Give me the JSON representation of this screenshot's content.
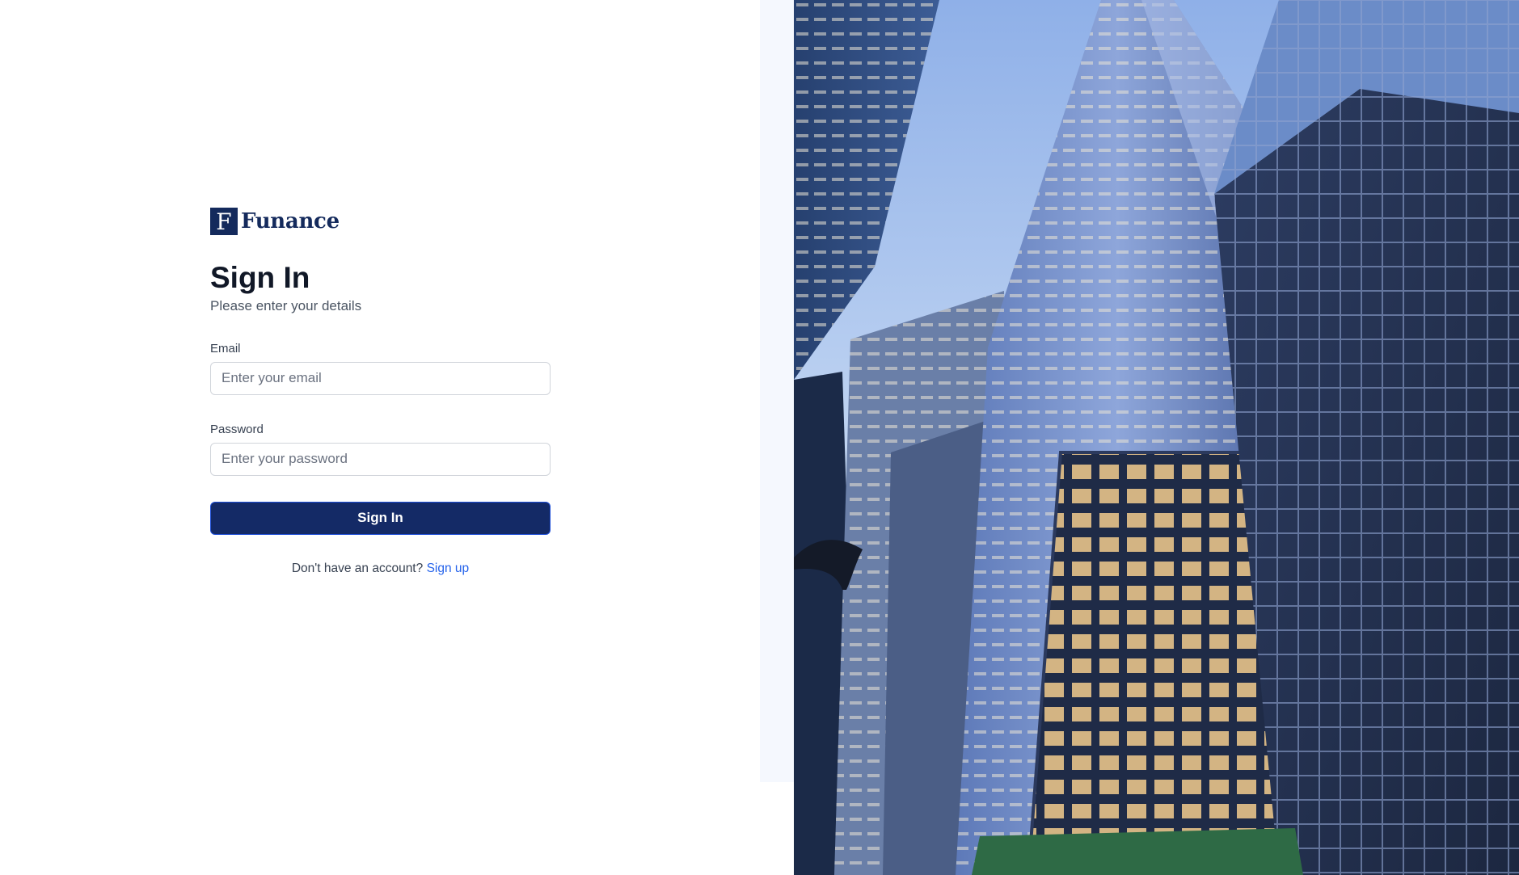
{
  "brand": {
    "mark": "F",
    "name": "Funance"
  },
  "form": {
    "title": "Sign In",
    "subtitle": "Please enter your details",
    "email": {
      "label": "Email",
      "placeholder": "Enter your email",
      "value": ""
    },
    "password": {
      "label": "Password",
      "placeholder": "Enter your password",
      "value": ""
    },
    "submit_label": "Sign In",
    "signup_prompt": "Don't have an account?",
    "signup_link": "Sign up"
  },
  "colors": {
    "brand_navy": "#142a5c",
    "button_bg": "#142a66",
    "link": "#2563eb",
    "side_strip": "#f5f8fe"
  },
  "hero": {
    "icon": "city-skyscrapers-image"
  }
}
